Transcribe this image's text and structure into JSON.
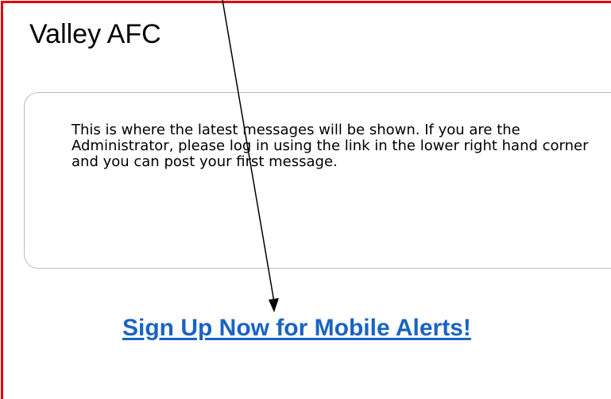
{
  "page": {
    "title": "Valley AFC",
    "messages_text": "This is where the latest messages will be shown. If you are the Administrator, please log in using the link in the lower right hand corner and you can post your first message.",
    "mobile_alerts_link": "Sign Up Now for Mobile Alerts!"
  },
  "colors": {
    "frame_border": "#e00000",
    "link": "#1a63c2",
    "panel_border": "#b7bbd6"
  }
}
